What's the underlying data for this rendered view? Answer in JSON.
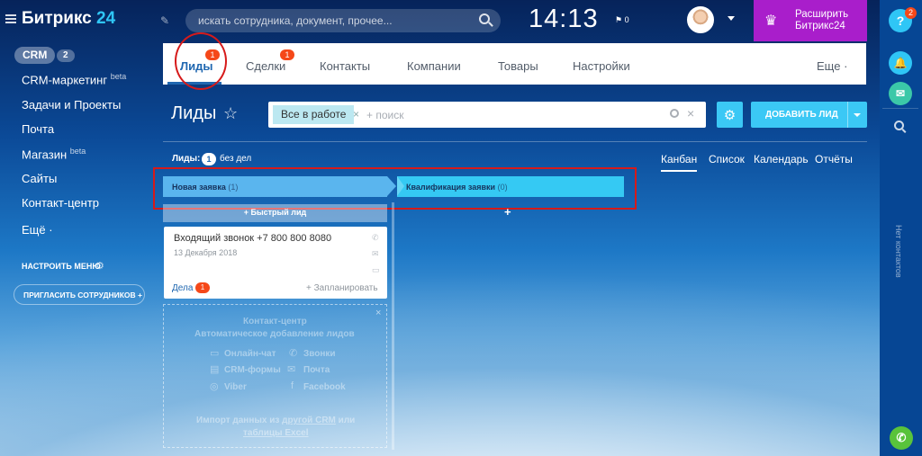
{
  "header": {
    "logo_text": "Битрикс",
    "logo_num": "24",
    "search_placeholder": "искать сотрудника, документ, прочее...",
    "clock": "14:13",
    "flag_count": "0",
    "expand_line1": "Расширить",
    "expand_line2": "Битрикс24"
  },
  "right_panel": {
    "help_label": "?",
    "help_badge": "2",
    "no_contacts": "Нет контактов"
  },
  "sidebar": {
    "crm_label": "CRM",
    "crm_count": "2",
    "items": [
      {
        "label": "CRM-маркетинг",
        "sup": "beta"
      },
      {
        "label": "Задачи и Проекты",
        "sup": ""
      },
      {
        "label": "Почта",
        "sup": ""
      },
      {
        "label": "Магазин",
        "sup": "beta"
      },
      {
        "label": "Сайты",
        "sup": ""
      },
      {
        "label": "Контакт-центр",
        "sup": ""
      },
      {
        "label": "Ещё ·",
        "sup": ""
      }
    ],
    "setup_label": "НАСТРОИТЬ МЕНЮ",
    "invite_label": "ПРИГЛАСИТЬ СОТРУДНИКОВ +"
  },
  "tabs": {
    "items": [
      {
        "label": "Лиды",
        "badge": "1"
      },
      {
        "label": "Сделки",
        "badge": "1"
      },
      {
        "label": "Контакты",
        "badge": ""
      },
      {
        "label": "Компании",
        "badge": ""
      },
      {
        "label": "Товары",
        "badge": ""
      },
      {
        "label": "Настройки",
        "badge": ""
      }
    ],
    "more_label": "Еще ·"
  },
  "page": {
    "title": "Лиды",
    "filter_tag": "Все в работе",
    "filter_placeholder": "+ поиск",
    "add_button": "ДОБАВИТЬ ЛИД"
  },
  "counter": {
    "label": "Лиды:",
    "count": "1",
    "suffix": "без дел"
  },
  "views": [
    "Канбан",
    "Список",
    "Календарь",
    "Отчёты"
  ],
  "stages": [
    {
      "name": "Новая заявка",
      "count": "(1)"
    },
    {
      "name": "Квалификация заявки",
      "count": "(0)"
    }
  ],
  "quick_lead": "+ Быстрый лид",
  "card": {
    "title": "Входящий звонок +7 800 800 8080",
    "date": "13 Декабря 2018",
    "deals_label": "Дела",
    "deals_count": "1",
    "planned": "+ Запланировать"
  },
  "contact_center": {
    "title": "Контакт-центр",
    "subtitle": "Автоматическое добавление лидов",
    "channels": [
      "Онлайн-чат",
      "Звонки",
      "CRM-формы",
      "Почта",
      "Viber",
      "Facebook"
    ],
    "import_line1": "Импорт данных из",
    "import_link": "другой CRM",
    "import_or": "или",
    "import_line2": "таблицы Excel"
  }
}
